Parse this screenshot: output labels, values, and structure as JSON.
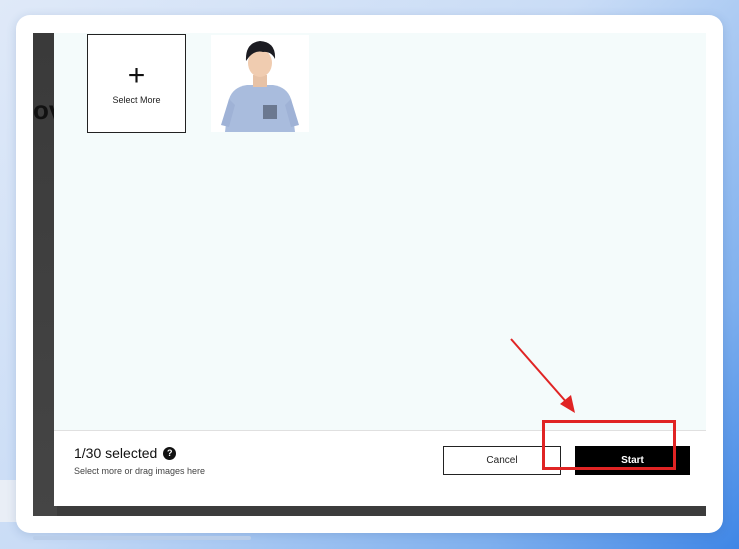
{
  "modal": {
    "select_more_label": "Select More",
    "selected_count": "1/30 selected",
    "help_icon_glyph": "?",
    "hint": "Select more or drag images here",
    "cancel_label": "Cancel",
    "start_label": "Start"
  },
  "background": {
    "partial_heading": "ov"
  },
  "annotation": {
    "highlight_color": "#e02424",
    "arrow_color": "#e02424"
  },
  "icons": {
    "plus": "plus-icon",
    "help": "question-circle-icon",
    "photo": "person-photo-thumbnail"
  }
}
